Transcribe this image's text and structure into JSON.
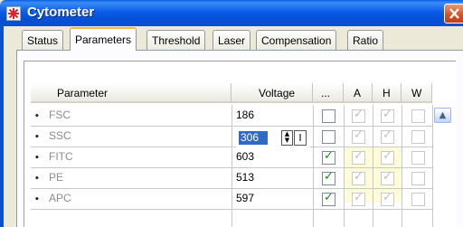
{
  "window": {
    "title": "Cytometer"
  },
  "tabs": [
    {
      "label": "Status"
    },
    {
      "label": "Parameters",
      "active": true
    },
    {
      "label": "Threshold"
    },
    {
      "label": "Laser"
    },
    {
      "label": "Compensation"
    },
    {
      "label": "Ratio"
    }
  ],
  "table": {
    "headers": {
      "parameter": "Parameter",
      "voltage": "Voltage",
      "dots": "...",
      "a": "A",
      "h": "H",
      "w": "W"
    },
    "rows": [
      {
        "name": "FSC",
        "voltage": "186",
        "log": false,
        "a": true,
        "h": true,
        "w": false
      },
      {
        "name": "SSC",
        "voltage": "306",
        "log": false,
        "a": true,
        "h": true,
        "w": false,
        "editing": true
      },
      {
        "name": "FITC",
        "voltage": "603",
        "log": true,
        "a": true,
        "h": true,
        "w": false
      },
      {
        "name": "PE",
        "voltage": "513",
        "log": true,
        "a": true,
        "h": true,
        "w": false
      },
      {
        "name": "APC",
        "voltage": "597",
        "log": true,
        "a": true,
        "h": true,
        "w": false
      }
    ]
  },
  "icons": {
    "app": "cytometer-app-icon",
    "close": "close-icon",
    "scroll_up": "scroll-up-icon"
  },
  "colors": {
    "titlebar": "#0a5fe0",
    "close": "#d4542a",
    "selection": "#316ac5",
    "highlight": "#fefbd9",
    "check": "#1a8a1a"
  }
}
